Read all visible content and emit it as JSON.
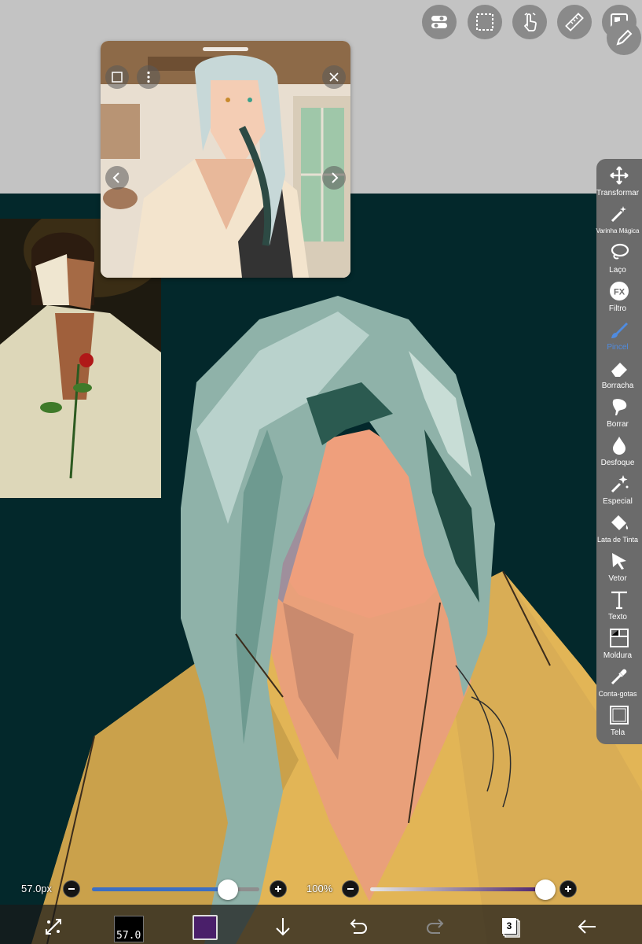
{
  "top_toolbar": {
    "buttons": [
      {
        "name": "toggle",
        "icon": "toggle-icon"
      },
      {
        "name": "selection",
        "icon": "selection-rect-icon"
      },
      {
        "name": "gesture",
        "icon": "hand-touch-icon"
      },
      {
        "name": "ruler",
        "icon": "ruler-icon"
      },
      {
        "name": "reference",
        "icon": "image-icon"
      }
    ],
    "pen_icon": "pen-icon"
  },
  "reference_window": {
    "icons": [
      "fit-square-icon",
      "more-vert-icon",
      "close-icon",
      "chevron-left-icon",
      "chevron-right-icon"
    ]
  },
  "tools": [
    {
      "id": "transformar",
      "label": "Transformar",
      "icon": "move-icon"
    },
    {
      "id": "varinha",
      "label": "Varinha Mágica",
      "icon": "magic-wand-icon"
    },
    {
      "id": "laco",
      "label": "Laço",
      "icon": "lasso-icon"
    },
    {
      "id": "filtro",
      "label": "Filtro",
      "icon": "fx-icon"
    },
    {
      "id": "pincel",
      "label": "Pincel",
      "icon": "brush-icon",
      "active": true
    },
    {
      "id": "borracha",
      "label": "Borracha",
      "icon": "eraser-icon"
    },
    {
      "id": "borrar",
      "label": "Borrar",
      "icon": "smudge-icon"
    },
    {
      "id": "desfoque",
      "label": "Desfoque",
      "icon": "blur-drop-icon"
    },
    {
      "id": "especial",
      "label": "Especial",
      "icon": "sparkle-icon"
    },
    {
      "id": "lata",
      "label": "Lata de Tinta",
      "icon": "paint-bucket-icon"
    },
    {
      "id": "vetor",
      "label": "Vetor",
      "icon": "vector-arrow-icon"
    },
    {
      "id": "texto",
      "label": "Texto",
      "icon": "text-t-icon"
    },
    {
      "id": "moldura",
      "label": "Moldura",
      "icon": "frame-icon"
    },
    {
      "id": "conta",
      "label": "Conta-gotas",
      "icon": "eyedropper-icon"
    },
    {
      "id": "tela",
      "label": "Tela",
      "icon": "canvas-icon"
    }
  ],
  "sliders": {
    "size_label": "57.0px",
    "size_fraction": 0.81,
    "opacity_label": "100%",
    "opacity_fraction": 1.0
  },
  "bottom_bar": {
    "brush_size_preview": "57.0",
    "current_color": "#4a1f6a",
    "layer_count": "3"
  },
  "colors": {
    "canvas_background": "#03282b",
    "ui_gray": "#c3c3c3",
    "tool_panel": "#6b6b6b",
    "accent": "#4f8be0"
  }
}
